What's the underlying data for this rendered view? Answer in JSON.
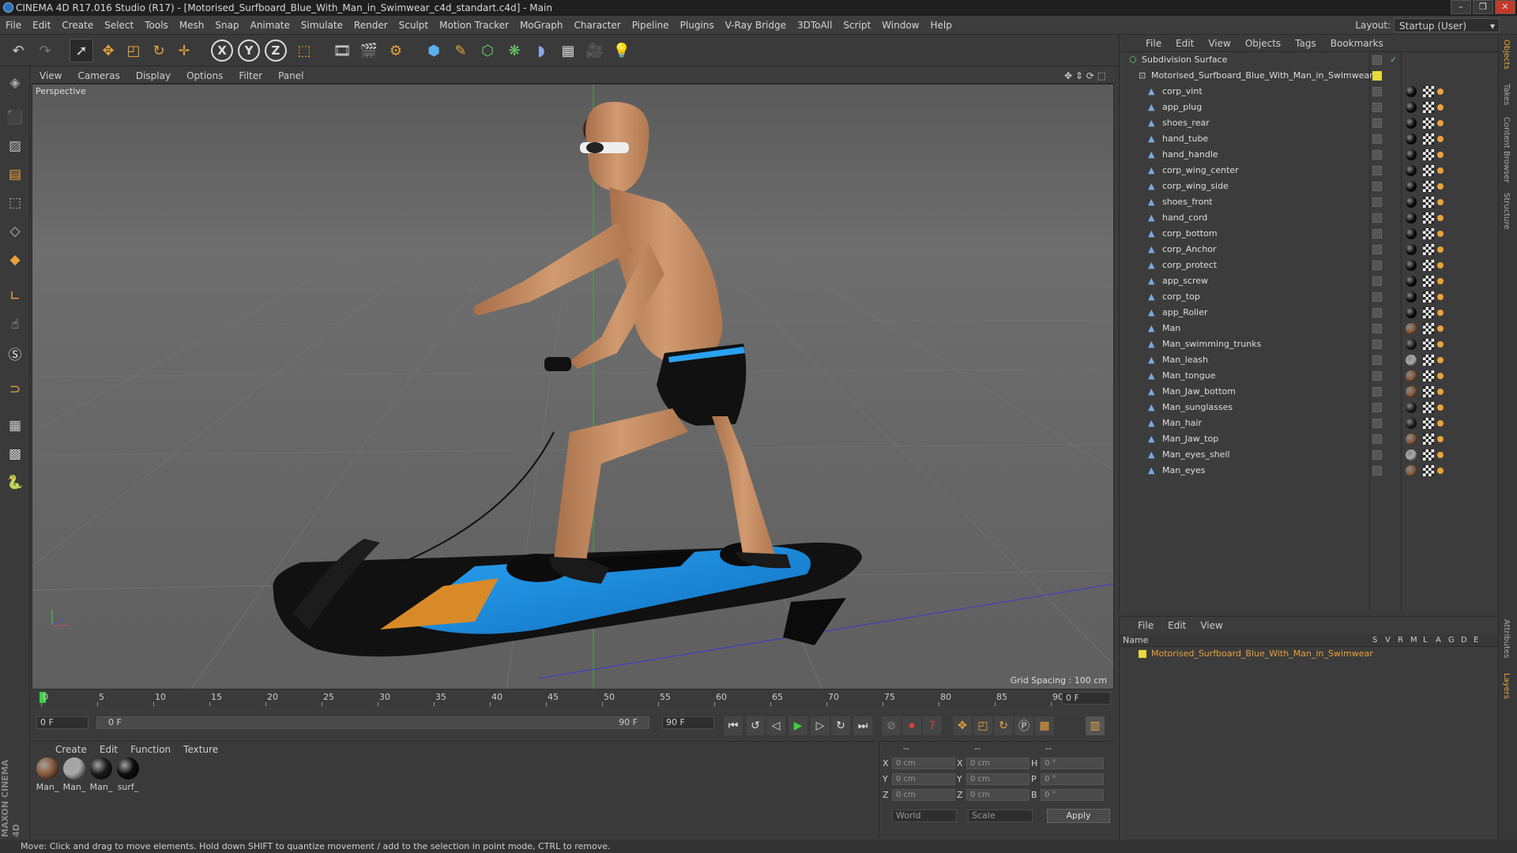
{
  "window": {
    "title": "CINEMA 4D R17.016 Studio (R17) - [Motorised_Surfboard_Blue_With_Man_in_Swimwear_c4d_standart.c4d] - Main",
    "controls": [
      "–",
      "❐",
      "✕"
    ]
  },
  "menubar": {
    "items": [
      "File",
      "Edit",
      "Create",
      "Select",
      "Tools",
      "Mesh",
      "Snap",
      "Animate",
      "Simulate",
      "Render",
      "Sculpt",
      "Motion Tracker",
      "MoGraph",
      "Character",
      "Pipeline",
      "Plugins",
      "V-Ray Bridge",
      "3DToAll",
      "Script",
      "Window",
      "Help"
    ],
    "layout_label": "Layout:",
    "layout_value": "Startup (User)"
  },
  "toolbar": {
    "axis_x": "X",
    "axis_y": "Y",
    "axis_z": "Z"
  },
  "viewport": {
    "menus": [
      "View",
      "Cameras",
      "Display",
      "Options",
      "Filter",
      "Panel"
    ],
    "label": "Perspective",
    "grid_spacing": "Grid Spacing : 100 cm"
  },
  "timeline": {
    "ticks": [
      "0",
      "5",
      "10",
      "15",
      "20",
      "25",
      "30",
      "35",
      "40",
      "45",
      "50",
      "55",
      "60",
      "65",
      "70",
      "75",
      "80",
      "85",
      "90"
    ],
    "current_frame": "0 F",
    "start_frame": "0 F",
    "range_start": "0 F",
    "range_end": "90 F",
    "end_frame": "90 F"
  },
  "materials": {
    "menus": [
      "Create",
      "Edit",
      "Function",
      "Texture"
    ],
    "items": [
      {
        "label": "Man_",
        "color": "#8a5a3a"
      },
      {
        "label": "Man_",
        "color": "#a8a8a8"
      },
      {
        "label": "Man_",
        "color": "#1a1a1a"
      },
      {
        "label": "surf_",
        "color": "#0d0d0d"
      }
    ]
  },
  "coordinates": {
    "header": [
      "--",
      "--",
      "--"
    ],
    "rows": [
      {
        "axis": "X",
        "pos": "0 cm",
        "axis2": "X",
        "size": "0 cm",
        "axis3": "H",
        "rot": "0 °"
      },
      {
        "axis": "Y",
        "pos": "0 cm",
        "axis2": "Y",
        "size": "0 cm",
        "axis3": "P",
        "rot": "0 °"
      },
      {
        "axis": "Z",
        "pos": "0 cm",
        "axis2": "Z",
        "size": "0 cm",
        "axis3": "B",
        "rot": "0 °"
      }
    ],
    "mode": "World",
    "scale": "Scale",
    "apply": "Apply"
  },
  "objects": {
    "menus": [
      "File",
      "Edit",
      "View",
      "Objects",
      "Tags",
      "Bookmarks"
    ],
    "root": "Subdivision Surface",
    "group": "Motorised_Surfboard_Blue_With_Man_in_Swimwear",
    "children": [
      {
        "name": "corp_vint",
        "tag": "#0c0c0c"
      },
      {
        "name": "app_plug",
        "tag": "#0c0c0c"
      },
      {
        "name": "shoes_rear",
        "tag": "#0c0c0c"
      },
      {
        "name": "hand_tube",
        "tag": "#0c0c0c"
      },
      {
        "name": "hand_handle",
        "tag": "#0c0c0c"
      },
      {
        "name": "corp_wing_center",
        "tag": "#0c0c0c"
      },
      {
        "name": "corp_wing_side",
        "tag": "#0c0c0c"
      },
      {
        "name": "shoes_front",
        "tag": "#0c0c0c"
      },
      {
        "name": "hand_cord",
        "tag": "#0c0c0c"
      },
      {
        "name": "corp_bottom",
        "tag": "#0c0c0c"
      },
      {
        "name": "corp_Anchor",
        "tag": "#0c0c0c"
      },
      {
        "name": "corp_protect",
        "tag": "#0c0c0c"
      },
      {
        "name": "app_screw",
        "tag": "#0c0c0c"
      },
      {
        "name": "corp_top",
        "tag": "#0c0c0c"
      },
      {
        "name": "app_Roller",
        "tag": "#0c0c0c"
      },
      {
        "name": "Man",
        "tag": "#8a5a3a"
      },
      {
        "name": "Man_swimming_trunks",
        "tag": "#1a1a1a"
      },
      {
        "name": "Man_leash",
        "tag": "#a8a8a8"
      },
      {
        "name": "Man_tongue",
        "tag": "#8a5a3a"
      },
      {
        "name": "Man_Jaw_bottom",
        "tag": "#8a5a3a"
      },
      {
        "name": "Man_sunglasses",
        "tag": "#1a1a1a"
      },
      {
        "name": "Man_hair",
        "tag": "#1a1a1a"
      },
      {
        "name": "Man_Jaw_top",
        "tag": "#8a5a3a"
      },
      {
        "name": "Man_eyes_shell",
        "tag": "#a8a8a8"
      },
      {
        "name": "Man_eyes",
        "tag": "#8a5a3a"
      }
    ]
  },
  "layers": {
    "menus": [
      "File",
      "Edit",
      "View"
    ],
    "col_name": "Name",
    "cols": [
      "S",
      "V",
      "R",
      "M",
      "L",
      "A",
      "G",
      "D",
      "E"
    ],
    "row": "Motorised_Surfboard_Blue_With_Man_in_Swimwear"
  },
  "right_tabs": [
    "Objects",
    "Takes",
    "Content Browser",
    "Structure",
    "Attributes",
    "Layers"
  ],
  "status": "Move: Click and drag to move elements. Hold down SHIFT to quantize movement / add to the selection in point mode, CTRL to remove.",
  "brand": "MAXON CINEMA 4D",
  "colors": {
    "accent": "#e8a33a",
    "highlight_text": "#e8a33a",
    "board_blue": "#1a8ae0"
  }
}
